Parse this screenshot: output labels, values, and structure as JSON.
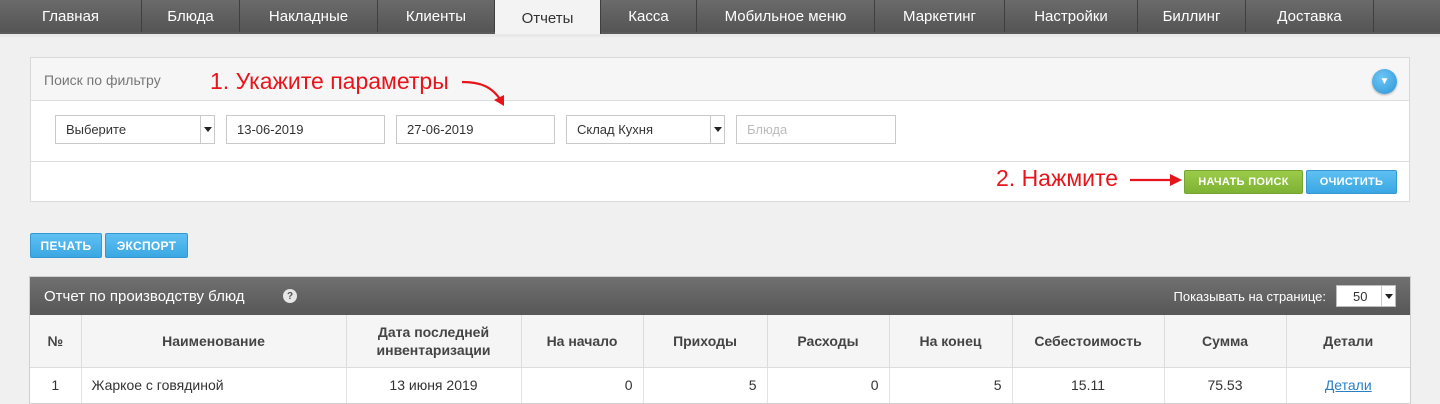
{
  "nav": {
    "tabs": [
      {
        "label": "Главная"
      },
      {
        "label": "Блюда"
      },
      {
        "label": "Накладные"
      },
      {
        "label": "Клиенты"
      },
      {
        "label": "Отчеты"
      },
      {
        "label": "Касса"
      },
      {
        "label": "Мобильное меню"
      },
      {
        "label": "Маркетинг"
      },
      {
        "label": "Настройки"
      },
      {
        "label": "Биллинг"
      },
      {
        "label": "Доставка"
      }
    ],
    "active": "Отчеты"
  },
  "filter": {
    "title": "Поиск по фильтру",
    "type_select": "Выберите",
    "date_from": "13-06-2019",
    "date_to": "27-06-2019",
    "warehouse_select": "Склад Кухня",
    "dish_placeholder": "Блюда",
    "search_label": "НАЧАТЬ ПОИСК",
    "clear_label": "ОЧИСТИТЬ"
  },
  "annotations": {
    "step1": "1. Укажите параметры",
    "step2": "2. Нажмите"
  },
  "actions": {
    "print_label": "ПЕЧАТЬ",
    "export_label": "ЭКСПОРТ"
  },
  "report": {
    "title": "Отчет по производству блюд",
    "help": "?",
    "per_page_label": "Показывать на странице:",
    "per_page_value": "50",
    "columns": [
      "№",
      "Наименование",
      "Дата последней инвентаризации",
      "На начало",
      "Приходы",
      "Расходы",
      "На конец",
      "Себестоимость",
      "Сумма",
      "Детали"
    ],
    "rows": [
      {
        "num": "1",
        "name": "Жаркое с говядиной",
        "last_inventory": "13 июня 2019",
        "start": "0",
        "income": "5",
        "expense": "0",
        "end": "5",
        "cost": "15.11",
        "sum": "75.53",
        "details": "Детали"
      }
    ]
  },
  "colors": {
    "accent_green": "#8cc03f",
    "accent_blue": "#4db4ec",
    "annotation_red": "#e8141b"
  }
}
